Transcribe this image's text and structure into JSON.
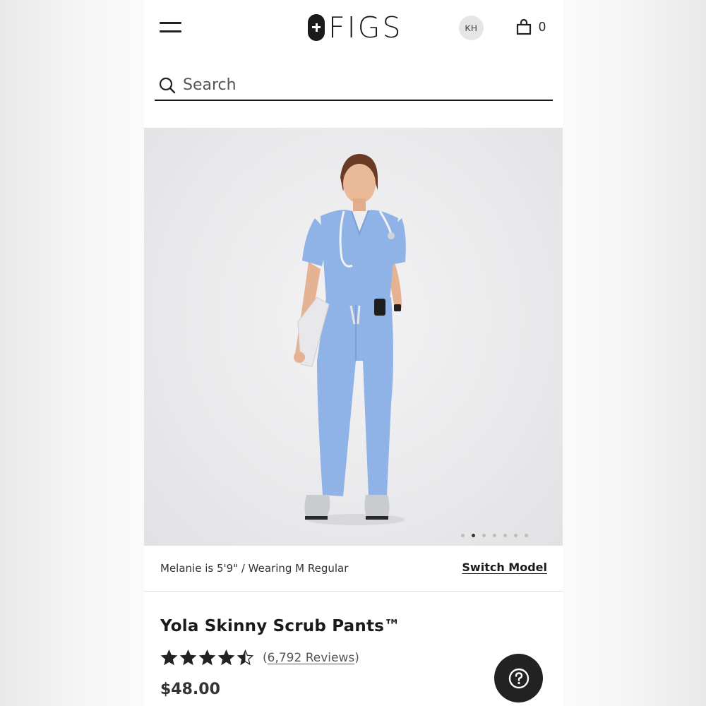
{
  "header": {
    "brand": "FIGS",
    "account_initials": "KH",
    "cart_count": "0"
  },
  "search": {
    "placeholder": "Search"
  },
  "gallery": {
    "image_count": 7,
    "active_index": 1
  },
  "model_info": {
    "text": "Melanie is 5'9\" / Wearing M Regular",
    "switch_label": "Switch Model"
  },
  "product": {
    "title": "Yola Skinny Scrub Pants™",
    "rating": 4.5,
    "reviews_open": "(",
    "reviews_label": "6,792 Reviews",
    "reviews_close": ")",
    "price": "$48.00"
  },
  "colors": {
    "scrub_blue": "#8fb3e6",
    "text": "#1a1a1a"
  },
  "icons": {
    "menu": "hamburger-menu-icon",
    "cart": "shopping-bag-icon",
    "search": "search-icon",
    "help": "question-mark-icon",
    "star": "star-icon"
  }
}
